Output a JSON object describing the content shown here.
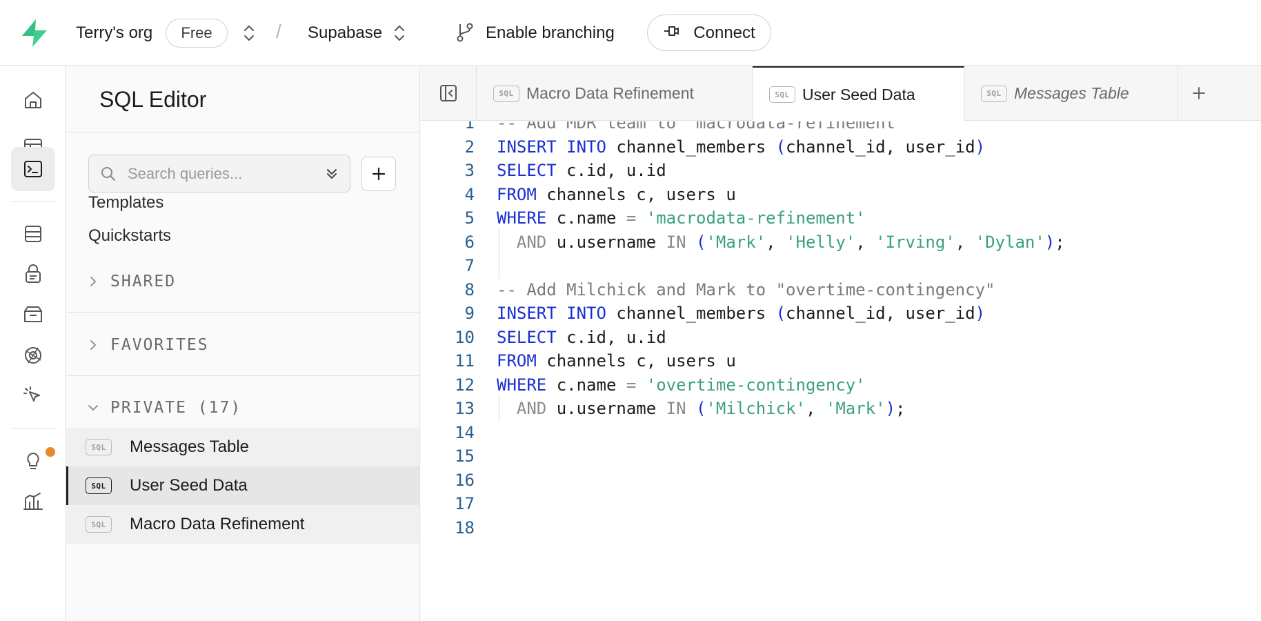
{
  "topbar": {
    "org_name": "Terry's org",
    "plan_badge": "Free",
    "separator": "/",
    "project_name": "Supabase",
    "branching_label": "Enable branching",
    "connect_label": "Connect",
    "brand_color": "#3ecf8e"
  },
  "rail": {
    "items": [
      {
        "icon": "home-icon"
      },
      {
        "icon": "table-editor-icon"
      },
      {
        "icon": "sql-editor-icon",
        "active": true
      },
      {
        "icon": "database-icon"
      },
      {
        "icon": "auth-lock-icon"
      },
      {
        "icon": "storage-icon"
      },
      {
        "icon": "realtime-icon"
      },
      {
        "icon": "cursor-icon"
      },
      {
        "icon": "advisor-bulb-icon",
        "badge_color": "#e7892c"
      },
      {
        "icon": "reports-icon"
      }
    ]
  },
  "sidebar": {
    "title": "SQL Editor",
    "search_placeholder": "Search queries...",
    "links": [
      "Templates",
      "Quickstarts"
    ],
    "sections": {
      "shared": "SHARED",
      "favorites": "FAVORITES",
      "private": "PRIVATE (17)"
    },
    "sql_chip": "SQL",
    "queries": [
      {
        "label": "Messages Table"
      },
      {
        "label": "User Seed Data",
        "active": true
      },
      {
        "label": "Macro Data Refinement"
      }
    ]
  },
  "tabs": [
    {
      "label": "Macro Data Refinement"
    },
    {
      "label": "User Seed Data",
      "active": true
    },
    {
      "label": "Messages Table",
      "italic": true
    }
  ],
  "editor": {
    "line_numbers": [
      "1",
      "2",
      "3",
      "4",
      "5",
      "6",
      "7",
      "8",
      "9",
      "10",
      "11",
      "12",
      "13",
      "14",
      "15",
      "16",
      "17",
      "18"
    ],
    "lines": [
      "-- Add MDR team to \"macrodata-refinement\"",
      "INSERT INTO channel_members (channel_id, user_id)",
      "SELECT c.id, u.id",
      "FROM channels c, users u",
      "WHERE c.name = 'macrodata-refinement'",
      "  AND u.username IN ('Mark', 'Helly', 'Irving', 'Dylan');",
      "",
      "-- Add Milchick and Mark to \"overtime-contingency\"",
      "INSERT INTO channel_members (channel_id, user_id)",
      "SELECT c.id, u.id",
      "FROM channels c, users u",
      "WHERE c.name = 'overtime-contingency'",
      "  AND u.username IN ('Milchick', 'Mark');",
      "",
      "",
      "",
      "",
      ""
    ]
  }
}
